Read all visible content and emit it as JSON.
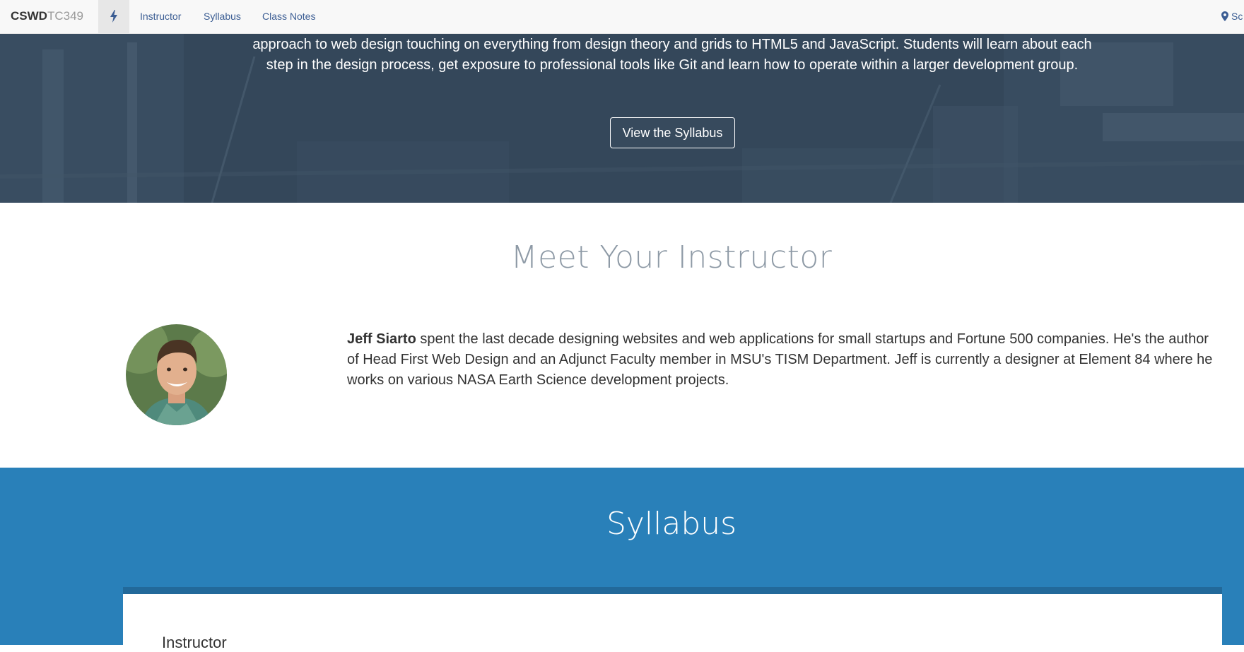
{
  "navbar": {
    "brand_strong": "CSWD",
    "brand_light": "TC349",
    "links": [
      "Instructor",
      "Syllabus",
      "Class Notes"
    ],
    "right_text": "Sc",
    "icons": {
      "quick": "bolt-icon",
      "location": "map-marker-icon"
    }
  },
  "hero": {
    "description": "approach to web design touching on everything from design theory and grids to HTML5 and JavaScript. Students will learn about each step in the design process, get exposure to professional tools like Git and learn how to operate within a larger development group.",
    "button_label": "View the Syllabus"
  },
  "instructor": {
    "heading": "Meet Your Instructor",
    "name": "Jeff Siarto",
    "bio": "spent the last decade designing websites and web applications for small startups and Fortune 500 companies. He's the author of Head First Web Design and an Adjunct Faculty member in MSU's TISM Department. Jeff is currently a designer at Element 84 where he works on various NASA Earth Science development projects."
  },
  "syllabus": {
    "heading": "Syllabus",
    "card_heading": "Instructor"
  },
  "colors": {
    "hero_overlay": "#34475a",
    "syllabus_bg": "#2980b9",
    "card_border": "#22699a",
    "nav_link": "#3b5d93",
    "section_title": "#8e9aa6"
  }
}
